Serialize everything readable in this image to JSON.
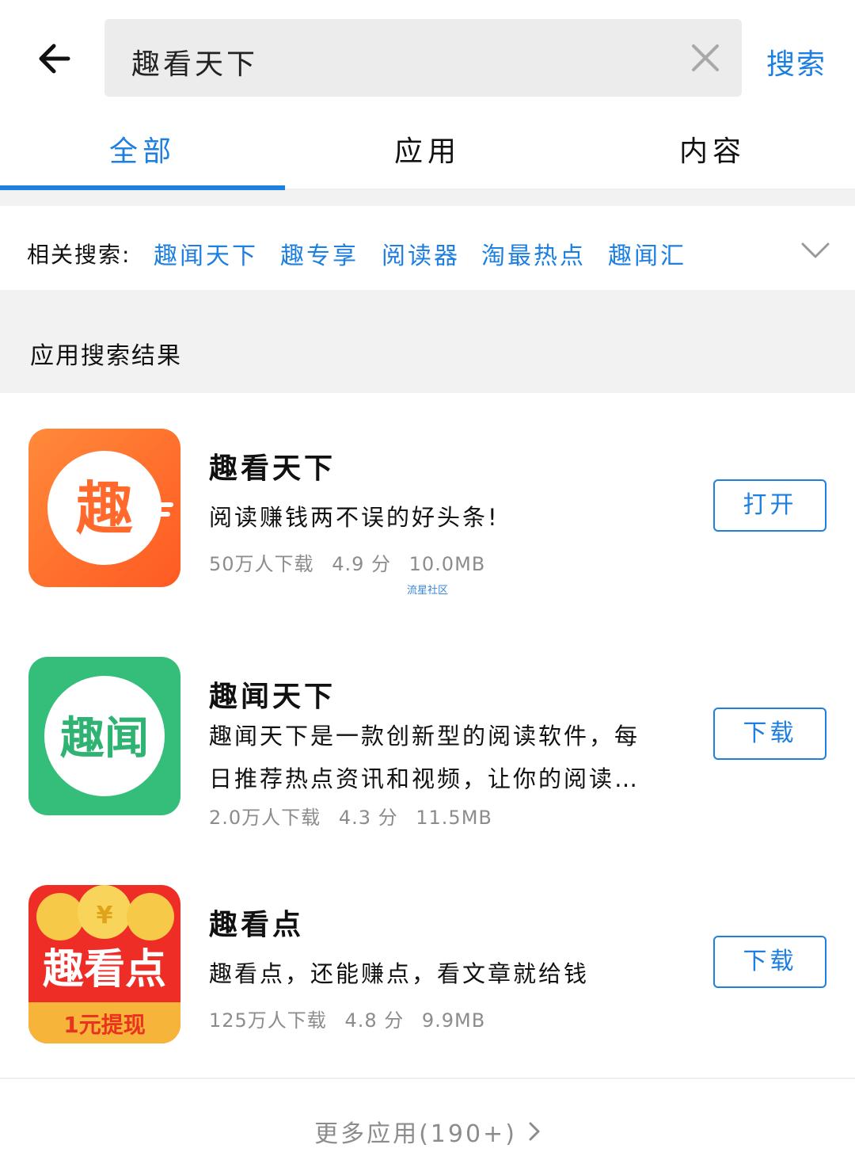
{
  "header": {
    "search_value": "趣看天下",
    "search_button": "搜索"
  },
  "tabs": [
    {
      "label": "全部",
      "active": true
    },
    {
      "label": "应用",
      "active": false
    },
    {
      "label": "内容",
      "active": false
    }
  ],
  "related": {
    "label": "相关搜索:",
    "items": [
      "趣闻天下",
      "趣专享",
      "阅读器",
      "淘最热点",
      "趣闻汇"
    ]
  },
  "section": {
    "title": "应用搜索结果"
  },
  "apps": [
    {
      "name": "趣看天下",
      "desc": "阅读赚钱两不误的好头条!",
      "downloads": "50万人下载",
      "rating": "4.9 分",
      "size": "10.0MB",
      "button": "打开",
      "icon_text": "趣",
      "icon_colors": [
        "#ff8a3a",
        "#ff5f26"
      ]
    },
    {
      "name": "趣闻天下",
      "desc": "趣闻天下是一款创新型的阅读软件，每日推荐热点资讯和视频，让你的阅读…",
      "downloads": "2.0万人下载",
      "rating": "4.3 分",
      "size": "11.5MB",
      "button": "下载",
      "icon_text": "趣闻",
      "icon_colors": [
        "#3ec482",
        "#2fb373"
      ]
    },
    {
      "name": "趣看点",
      "desc": "趣看点，还能赚点，看文章就给钱",
      "downloads": "125万人下载",
      "rating": "4.8 分",
      "size": "9.9MB",
      "button": "下载",
      "icon_text": "趣看点",
      "icon_badge": "1元提现",
      "icon_colors": [
        "#f0332a",
        "#d8231c"
      ]
    }
  ],
  "watermark": "流星社区",
  "footer": {
    "more_label": "更多应用(190+)"
  },
  "colors": {
    "accent": "#1d7fe0",
    "muted": "#8c8c8c",
    "divider": "#f2f2f2"
  }
}
